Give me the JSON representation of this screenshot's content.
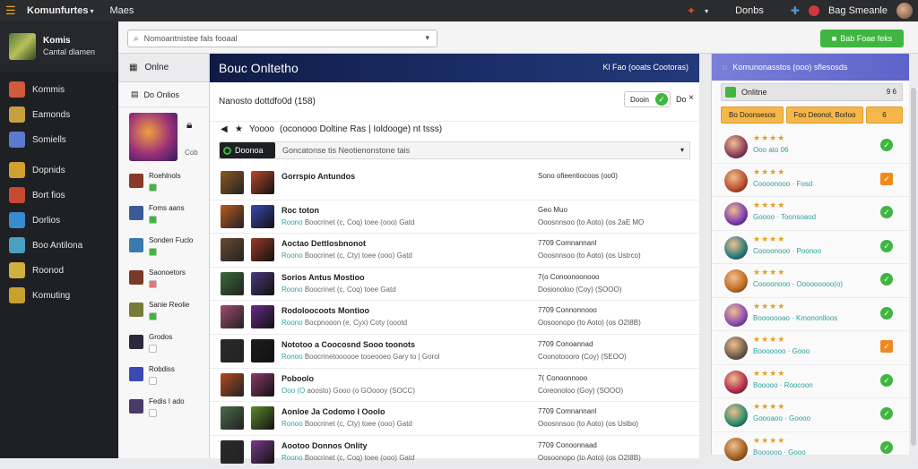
{
  "topbar": {
    "app_title": "Komunfurtes",
    "menu_label": "Maes",
    "right_label": "Donbs",
    "user_label": "Bag Smeanle"
  },
  "profile": {
    "name": "Komis",
    "subtitle": "Cantal dlamen"
  },
  "sidebar": {
    "items": [
      {
        "label": "Kommis",
        "icon": "home-icon",
        "color": "#d05a3a"
      },
      {
        "label": "Eamonds",
        "icon": "gamepad-icon",
        "color": "#c4a040"
      },
      {
        "label": "Somiells",
        "icon": "search-icon",
        "color": "#5a7ad0"
      },
      {
        "label": "Dopnids",
        "icon": "folder-icon",
        "color": "#d0a030"
      },
      {
        "label": "Bort fios",
        "icon": "game-icon",
        "color": "#c84a30"
      },
      {
        "label": "Dorlios",
        "icon": "controller-icon",
        "color": "#3a8ad0"
      },
      {
        "label": "Boo Antilona",
        "icon": "puzzle-icon",
        "color": "#4aa0c0"
      },
      {
        "label": "Roonod",
        "icon": "trophy-icon",
        "color": "#d0b040"
      },
      {
        "label": "Komuting",
        "icon": "star-icon",
        "color": "#c8a030"
      }
    ]
  },
  "search": {
    "placeholder": "Nomoantnistee fals fooaal"
  },
  "add_button": {
    "label": "Bab Foae feks"
  },
  "leftpanel": {
    "title": "Onlne",
    "subtitle": "Do Onlios",
    "featured_tag": "Cob",
    "rows": [
      {
        "label": "Roehlnols"
      },
      {
        "label": "Foms aans"
      },
      {
        "label": "Sonden Fuclo"
      },
      {
        "label": "Saonoetors"
      },
      {
        "label": "Sanie Reolie"
      },
      {
        "label": "Grodos"
      },
      {
        "label": "Robdiss"
      },
      {
        "label": "Fedis I ado"
      }
    ]
  },
  "main": {
    "title": "Bouc Onltetho",
    "header_right": "Kl Fao (ooats Cootoras)",
    "filter_label": "Nanosto dottdfo0d (158)",
    "toggle_label": "Dooin",
    "toggle_extra": "Do",
    "crumb_a": "Yoooo",
    "crumb_b": "(oconooo Doltine Ras | Ioldooge) nt tsss)",
    "section_tag": "Doonoa",
    "section_text": "Goncatonse tis Neotienonstone tais"
  },
  "games": [
    {
      "name": "Gorrspio Antundos",
      "desc_teal": "",
      "desc": "",
      "right1": "Sono ofieentiocoos (oo0)",
      "right2": "",
      "c1": "#8a5a20",
      "c2": "#b84a2a"
    },
    {
      "name": "Roc toton",
      "desc_teal": "Roono",
      "desc": "Boocrinet (c, Coq) toee (ooo) Gatd",
      "right1": "Geo Muo",
      "right2": "Ooosnnsoo (to Aoto) (os 2aE MO",
      "c1": "#b85a20",
      "c2": "#3a4ab0"
    },
    {
      "name": "Aoctao Dettlosbnonot",
      "desc_teal": "Roono",
      "desc": "Boocrinet (c, Cty) toee (ooo) Gatd",
      "right1": "7709 Comnannanl",
      "right2": "Ooosnnsoo (to Aoto) (os Ustrco)",
      "c1": "#6a4a30",
      "c2": "#9a3a2a"
    },
    {
      "name": "Sorios Antus Mostioo",
      "desc_teal": "Roono",
      "desc": "Boocrinet (c, Coq) toee Gatd",
      "right1": "7(o Conoonoonooo",
      "right2": "Dosionoloo (Coy) (SOOO)",
      "c1": "#3a6a3a",
      "c2": "#4a3a7a"
    },
    {
      "name": "Rodoloocoots Montioo",
      "desc_teal": "Roono",
      "desc": "Bocpnooon (e, Cyx) Coty (oootd",
      "right1": "7709 Connonnooo",
      "right2": "Oosoonopo (to Aoto) (os O2I8B)",
      "c1": "#a04a6a",
      "c2": "#6a2a8a"
    },
    {
      "name": "Nototoo a Coocosnd Sooo toonots",
      "desc_teal": "Ronoo",
      "desc": "Boocrinetoooooe tooeooeo Gary to | Gorol",
      "right1": "7709 Conoannad",
      "right2": "Coonotoooro (Coy) (SEOO)",
      "c1": "#2a2a2a",
      "c2": "#1e1e1e"
    },
    {
      "name": "Poboolo",
      "desc_teal": "Ooo (O",
      "desc": "aoosto) Gooo (o GOoooy (SOCC)",
      "right1": "7( Conoonnooo",
      "right2": "Coreonoloo (Goy) (SOOO)",
      "c1": "#b04a20",
      "c2": "#8a3a6a"
    },
    {
      "name": "Aonloe Ja Codomo I Ooolo",
      "desc_teal": "Ronoo",
      "desc": "Boocrinet (c, Cty) toee (ooo) Gatd",
      "right1": "7709 Comnannanl",
      "right2": "Ooosnnsoo (to Aoto) (os Uslbo)",
      "c1": "#4a6a4a",
      "c2": "#5a8a2a"
    },
    {
      "name": "Aootoo Donnos Onlity",
      "desc_teal": "Roono",
      "desc": "Boocrinet (c, Coq) toee (ooo) Gatd",
      "right1": "7709 Conoonnaad",
      "right2": "Oosoonopo (to Aoto) (os O2I8B)",
      "c1": "#2a2a2a",
      "c2": "#7a3a8a"
    }
  ],
  "rightpanel": {
    "header": "Komunonasstos (ooo) sflesosds",
    "online_label": "Onlitne",
    "online_dots": "9 6",
    "btn1": "Bo Doonsesos",
    "btn2": "Foo Deonol, Borloo",
    "btn3": "6",
    "stars": "★★★★",
    "items": [
      {
        "desc": "Ooo ato 06",
        "status": "ok",
        "color": "#8a3a5a"
      },
      {
        "desc": "Coooonooo · Fosd",
        "status": "warn",
        "color": "#b84a2a"
      },
      {
        "desc": "Goooo · Toonsoaod",
        "status": "ok",
        "color": "#7a3ab0"
      },
      {
        "desc": "Coooonooo · Poonoo",
        "status": "ok",
        "color": "#2a7a7a"
      },
      {
        "desc": "Coooonooo · Ooooooooo(o)",
        "status": "ok",
        "color": "#c06a20"
      },
      {
        "desc": "Booooooao · Kmononlloos",
        "status": "ok",
        "color": "#8a4ab0"
      },
      {
        "desc": "Booooooo · Gooo",
        "status": "warn",
        "color": "#6a5a4a"
      },
      {
        "desc": "Booooo · Roocoon",
        "status": "ok",
        "color": "#b02a4a"
      },
      {
        "desc": "Goooaoo · Goooo",
        "status": "ok",
        "color": "#2a8a6a"
      },
      {
        "desc": "Boooooo · Gooo",
        "status": "ok",
        "color": "#a05a20"
      }
    ]
  }
}
